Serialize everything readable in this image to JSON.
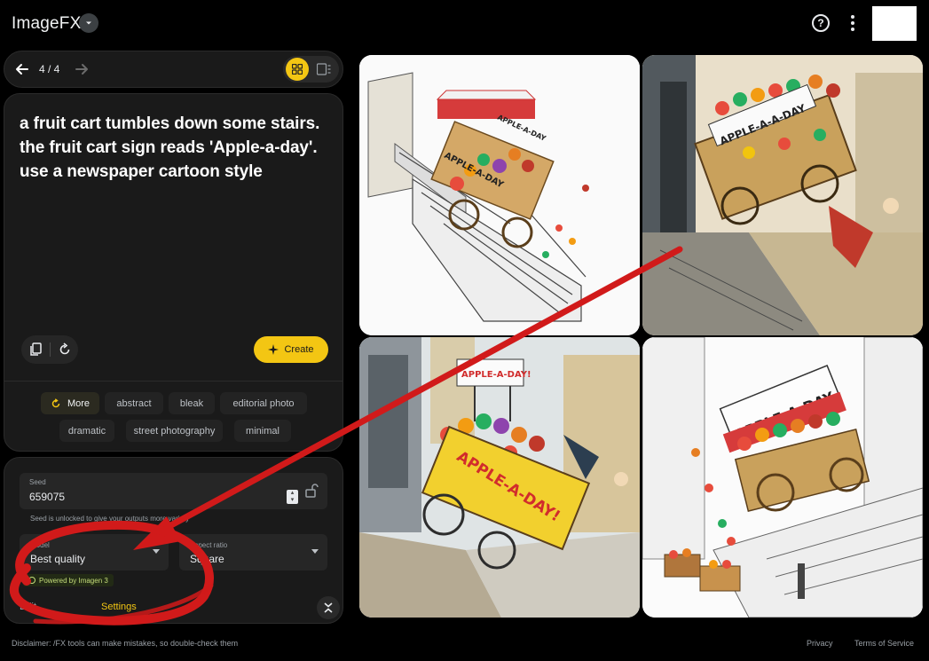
{
  "app": {
    "title": "ImageFX"
  },
  "header": {
    "caret_icon": "chevron-down-icon",
    "help_icon": "help-circle-icon",
    "more_icon": "more-vert-icon"
  },
  "nav": {
    "counter": "4 / 4",
    "back_icon": "arrow-back-icon",
    "forward_icon": "arrow-forward-icon",
    "view_grid_icon": "grid-view-icon",
    "view_single_icon": "single-view-icon"
  },
  "prompt": {
    "text": "a fruit cart tumbles down some stairs. the fruit cart sign reads 'Apple-a-day'. use a newspaper cartoon style",
    "create_label": "Create",
    "copy_icon": "copy-icon",
    "refresh_icon": "refresh-icon"
  },
  "chips": {
    "more": "More",
    "items": [
      "abstract",
      "bleak",
      "editorial photo",
      "dramatic",
      "street photography",
      "minimal"
    ]
  },
  "settings": {
    "seed_label": "Seed",
    "seed_value": "659075",
    "seed_hint": "Seed is unlocked to give your outputs more variety",
    "model_label": "Model",
    "model_value": "Best quality",
    "aspect_label": "Aspect ratio",
    "aspect_value": "Square",
    "powered_by": "Powered by Imagen 3",
    "tab_edit": "Edit",
    "tab_settings": "Settings"
  },
  "images": {
    "img1_sign": "APPLE-A-DAY",
    "img2_sign": "APPLE-A-A-DAY",
    "img3_sign": "APPLE-A-DAY!",
    "img4_sign": "APPLE-A-DAY"
  },
  "footer": {
    "disclaimer": "Disclaimer: /FX tools can make mistakes, so double-check them",
    "privacy": "Privacy",
    "terms": "Terms of Service"
  },
  "colors": {
    "accent": "#f3c613",
    "background": "#000000",
    "card": "#1a1a1a",
    "annotation": "#d11a1a"
  }
}
